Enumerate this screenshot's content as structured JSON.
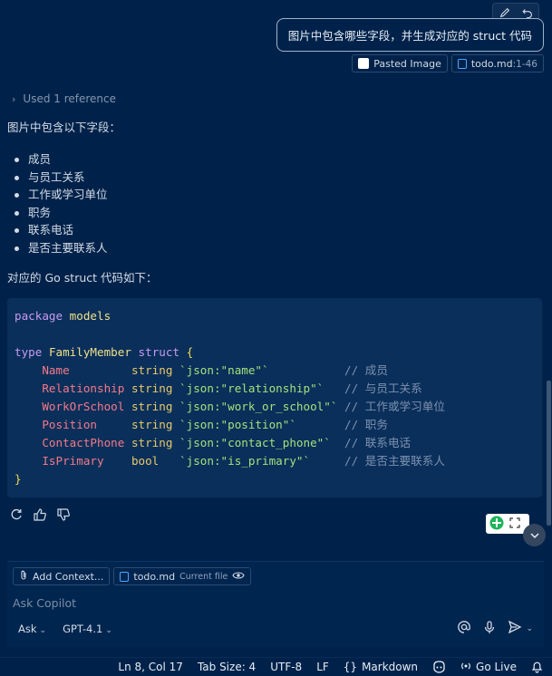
{
  "user_message": "图片中包含哪些字段，并生成对应的 struct 代码",
  "attachments": [
    {
      "label": "Pasted Image",
      "icon": "image-icon"
    },
    {
      "label": "todo.md",
      "range": ":1-46",
      "icon": "file-icon"
    }
  ],
  "reference": "Used 1 reference",
  "answer": {
    "intro": "图片中包含以下字段：",
    "fields": [
      "成员",
      "与员工关系",
      "工作或学习单位",
      "职务",
      "联系电话",
      "是否主要联系人"
    ],
    "code_intro": "对应的 Go struct 代码如下："
  },
  "code": {
    "package_kw": "package",
    "package_name": "models",
    "type_kw": "type",
    "type_name": "FamilyMember",
    "struct_kw": "struct",
    "open_brace": "{",
    "close_brace": "}",
    "lines": [
      {
        "name": "Name",
        "type": "string",
        "tag": "`json:\"name\"`",
        "comment": "// 成员"
      },
      {
        "name": "Relationship",
        "type": "string",
        "tag": "`json:\"relationship\"`",
        "comment": "// 与员工关系"
      },
      {
        "name": "WorkOrSchool",
        "type": "string",
        "tag": "`json:\"work_or_school\"`",
        "comment": "// 工作或学习单位"
      },
      {
        "name": "Position",
        "type": "string",
        "tag": "`json:\"position\"`",
        "comment": "// 职务"
      },
      {
        "name": "ContactPhone",
        "type": "string",
        "tag": "`json:\"contact_phone\"`",
        "comment": "// 联系电话"
      },
      {
        "name": "IsPrimary",
        "type": "bool",
        "tag": "`json:\"is_primary\"`",
        "comment": "// 是否主要联系人"
      }
    ]
  },
  "input": {
    "add_context": "Add Context...",
    "current_file": "todo.md",
    "current_file_note": "Current file",
    "placeholder": "Ask Copilot",
    "mode": "Ask",
    "model": "GPT-4.1"
  },
  "statusbar": {
    "position": "Ln 8, Col 17",
    "tab_size": "Tab Size: 4",
    "encoding": "UTF-8",
    "eol": "LF",
    "language": "Markdown",
    "live": "Go Live"
  },
  "colors": {
    "background": "#00224a",
    "code_background": "#0a2f5a",
    "accent": "#4aa8ff"
  }
}
